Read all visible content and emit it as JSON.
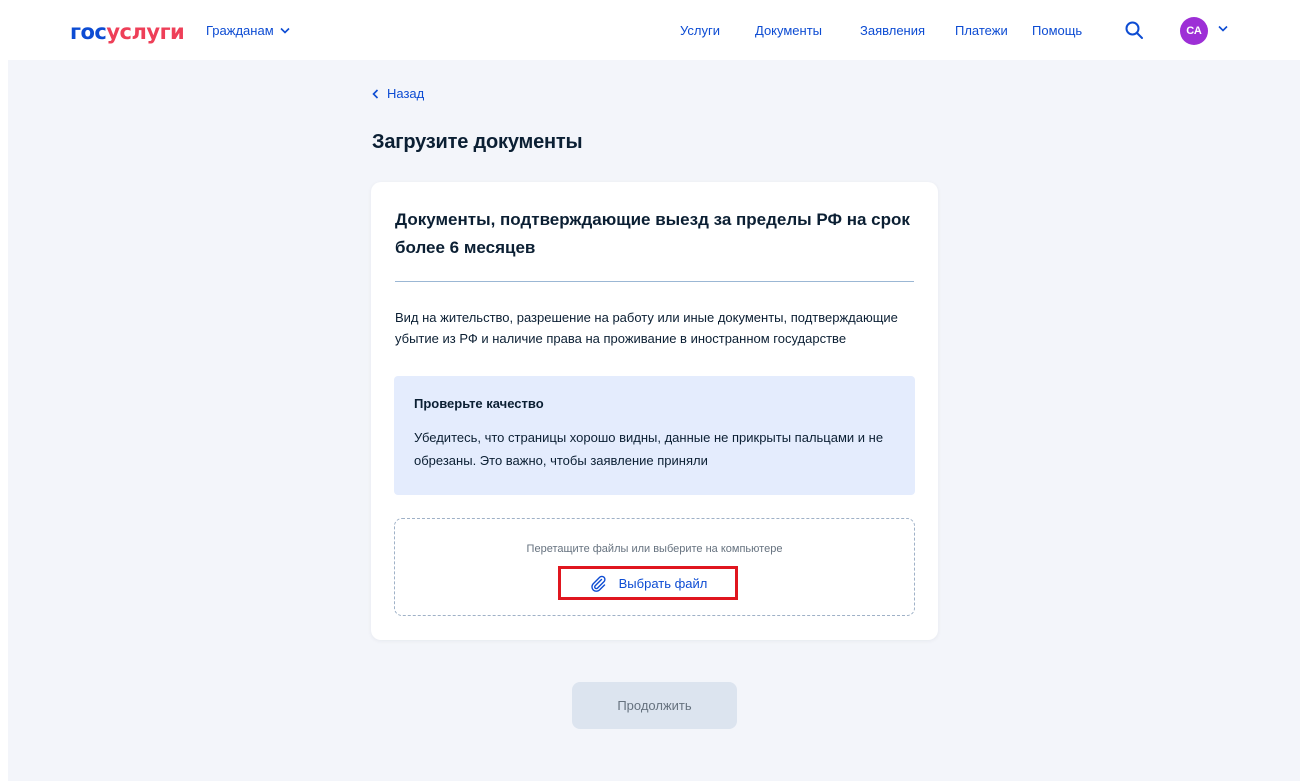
{
  "header": {
    "logo_part1": "гос",
    "logo_part2": "услуги",
    "audience": "Гражданам",
    "nav": [
      "Услуги",
      "Документы",
      "Заявления",
      "Платежи",
      "Помощь"
    ],
    "avatar_initials": "СА",
    "colors": {
      "brand_blue": "#0d4cd3",
      "brand_red": "#ee3f58",
      "avatar": "#9d2fd6"
    }
  },
  "page": {
    "back_label": "Назад",
    "title": "Загрузите документы"
  },
  "card": {
    "title": "Документы, подтверждающие выезд за пределы РФ на срок более 6 месяцев",
    "description": "Вид на жительство, разрешение на работу или иные документы, подтверждающие убытие из РФ и наличие права на проживание в иностранном государстве",
    "notice": {
      "title": "Проверьте качество",
      "text": "Убедитесь, что страницы хорошо видны, данные не прикрыты пальцами и не обрезаны. Это важно, чтобы заявление приняли"
    },
    "upload": {
      "hint": "Перетащите файлы или выберите на компьютере",
      "button_label": "Выбрать файл",
      "icon": "paperclip-icon"
    }
  },
  "footer": {
    "continue_label": "Продолжить"
  }
}
